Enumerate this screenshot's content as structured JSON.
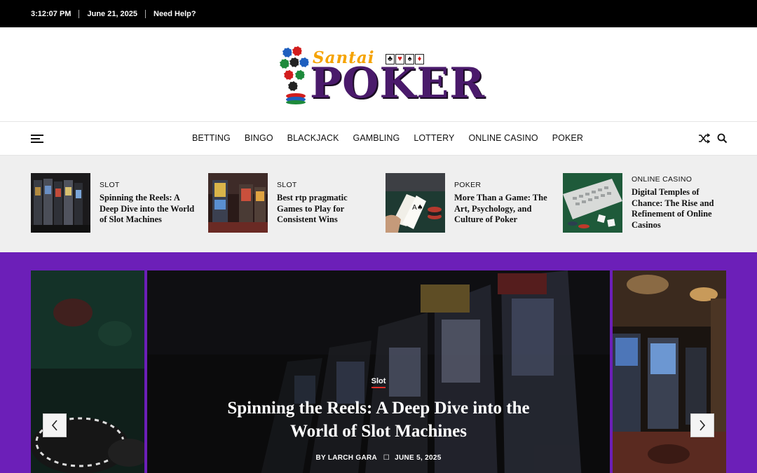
{
  "topbar": {
    "time": "3:12:07 PM",
    "date": "June 21, 2025",
    "help": "Need Help?"
  },
  "logo": {
    "santai": "Santai",
    "poker": "POKER",
    "card_suits": [
      "♣",
      "♥",
      "♠",
      "♦"
    ]
  },
  "nav": {
    "items": [
      "BETTING",
      "BINGO",
      "BLACKJACK",
      "GAMBLING",
      "LOTTERY",
      "ONLINE CASINO",
      "POKER"
    ]
  },
  "trending": [
    {
      "category": "SLOT",
      "title": "Spinning the Reels: A Deep Dive into the World of Slot Machines"
    },
    {
      "category": "SLOT",
      "title": "Best rtp pragmatic Games to Play for Consistent Wins"
    },
    {
      "category": "POKER",
      "title": "More Than a Game: The Art, Psychology, and Culture of Poker"
    },
    {
      "category": "ONLINE CASINO",
      "title": "Digital Temples of Chance: The Rise and Refinement of Online Casinos"
    }
  ],
  "hero": {
    "category": "Slot",
    "title": "Spinning the Reels: A Deep Dive into the World of Slot Machines",
    "author": "BY LARCH GARA",
    "date": "JUNE 5, 2025"
  },
  "colors": {
    "accent_purple": "#6c1fb8",
    "logo_purple": "#4a1a6b",
    "logo_orange": "#f5a300",
    "category_underline": "#e52d27"
  }
}
